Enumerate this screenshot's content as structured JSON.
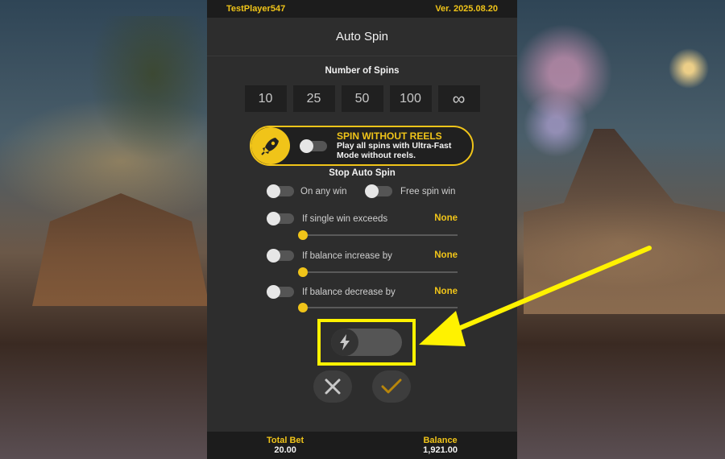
{
  "topbar": {
    "player": "TestPlayer547",
    "version": "Ver. 2025.08.20"
  },
  "header": {
    "title": "Auto Spin"
  },
  "spins": {
    "title": "Number of Spins",
    "options": [
      "10",
      "25",
      "50",
      "100",
      "∞"
    ]
  },
  "reels": {
    "title": "SPIN WITHOUT REELS",
    "desc_line1": "Play all spins with Ultra-Fast",
    "desc_line2": "Mode without reels."
  },
  "stop": {
    "title": "Stop Auto Spin",
    "on_any_win": "On any win",
    "free_spin_win": "Free spin win",
    "single_win": {
      "label": "If single win exceeds",
      "value": "None",
      "level": 0
    },
    "balance_increase": {
      "label": "If balance increase by",
      "value": "None",
      "level": 0
    },
    "balance_decrease": {
      "label": "If balance decrease by",
      "value": "None",
      "level": 0
    }
  },
  "footer": {
    "total_bet_label": "Total Bet",
    "total_bet_value": "20.00",
    "balance_label": "Balance",
    "balance_value": "1,921.00"
  },
  "colors": {
    "accent": "#f0c419",
    "highlight": "#fff200",
    "panel": "#2d2d2d"
  },
  "icons": [
    "rocket-icon",
    "lightning-icon",
    "close-icon",
    "check-icon",
    "infinity-icon"
  ]
}
